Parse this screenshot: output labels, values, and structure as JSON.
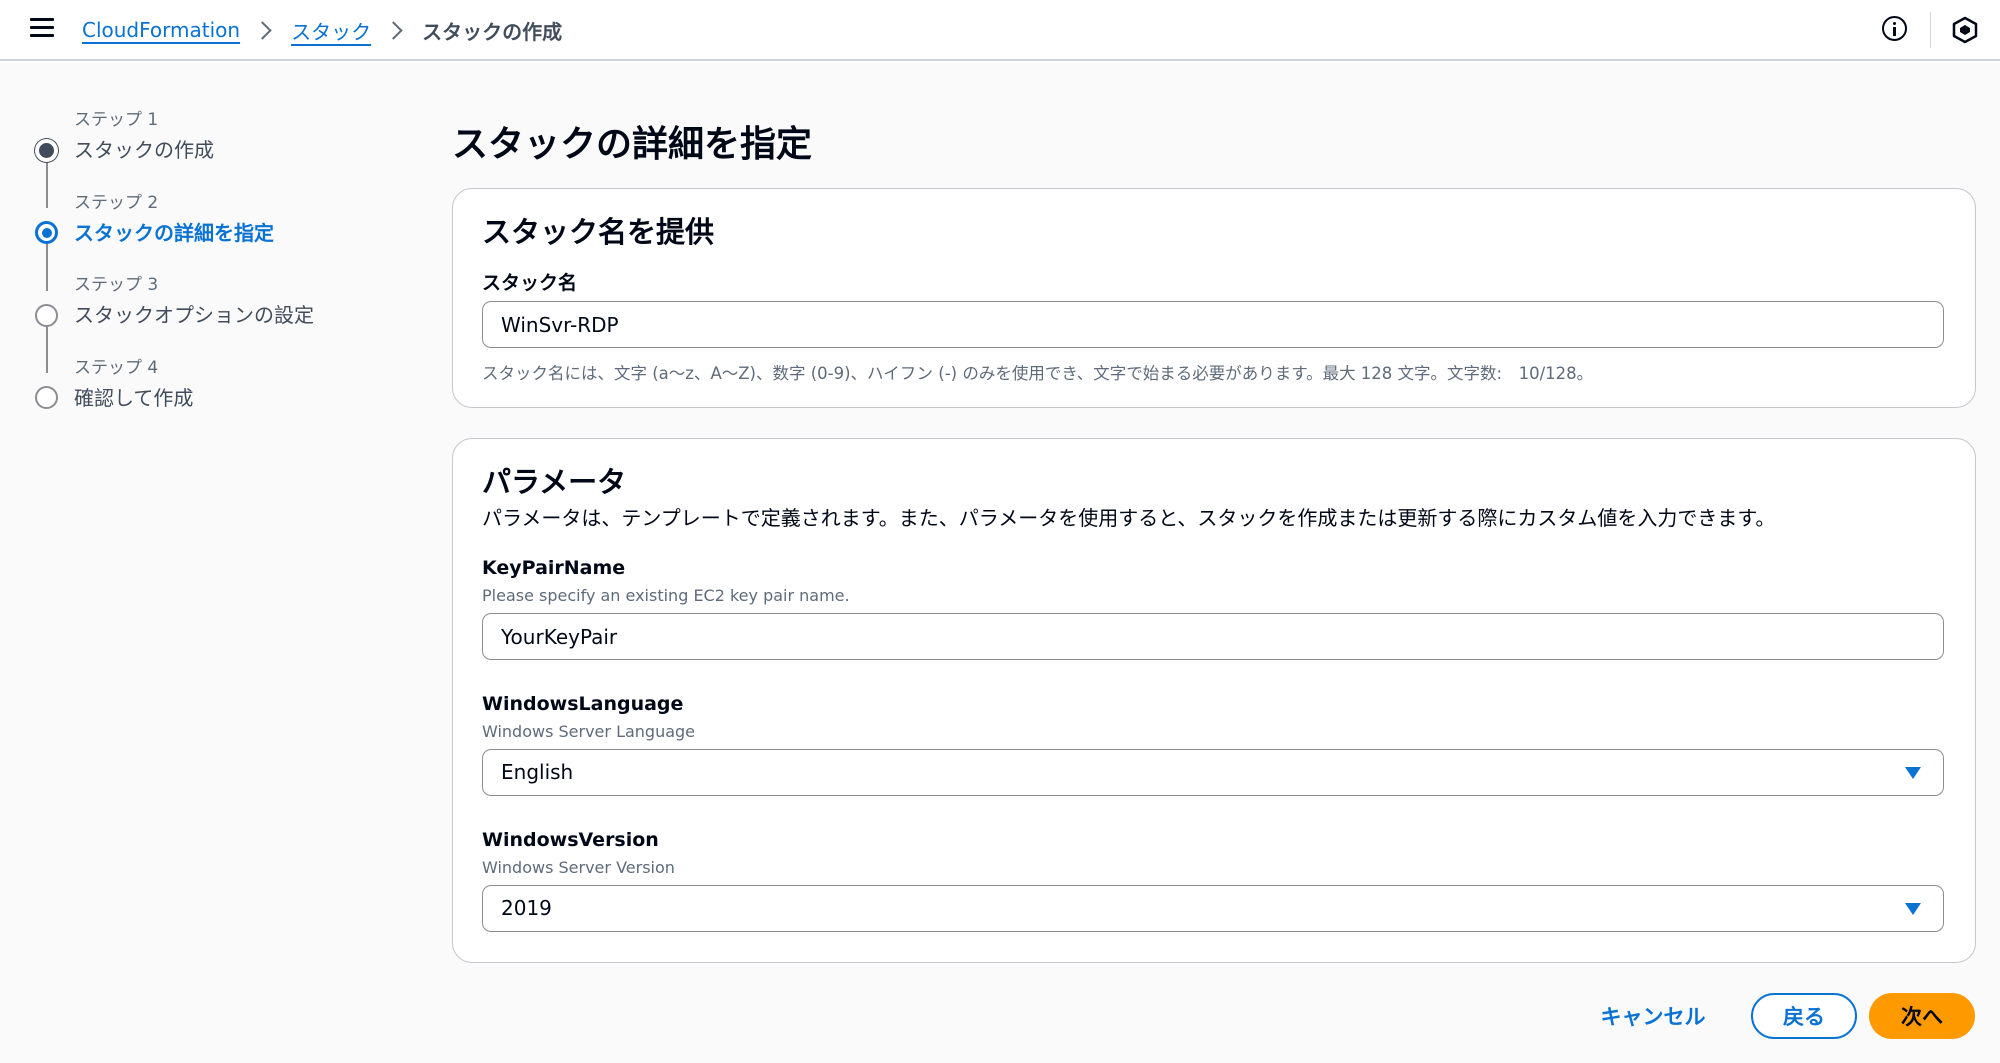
{
  "breadcrumb": {
    "items": [
      "CloudFormation",
      "スタック"
    ],
    "current": "スタックの作成"
  },
  "icons": {
    "menu": "hamburger-menu-icon",
    "info": "info-icon",
    "notifications": "hexagon-icon"
  },
  "steps": [
    {
      "number": "ステップ 1",
      "title": "スタックの作成",
      "state": "done"
    },
    {
      "number": "ステップ 2",
      "title": "スタックの詳細を指定",
      "state": "current"
    },
    {
      "number": "ステップ 3",
      "title": "スタックオプションの設定",
      "state": "future"
    },
    {
      "number": "ステップ 4",
      "title": "確認して作成",
      "state": "future"
    }
  ],
  "page_title": "スタックの詳細を指定",
  "stack_name_section": {
    "heading": "スタック名を提供",
    "label": "スタック名",
    "value": "WinSvr-RDP",
    "constraint": "スタック名には、文字 (a〜z、A〜Z)、数字 (0-9)、ハイフン (-) のみを使用でき、文字で始まる必要があります。最大 128 文字。文字数:　10/128。"
  },
  "parameters_section": {
    "heading": "パラメータ",
    "description": "パラメータは、テンプレートで定義されます。また、パラメータを使用すると、スタックを作成または更新する際にカスタム値を入力できます。",
    "fields": [
      {
        "label": "KeyPairName",
        "description": "Please specify an existing EC2 key pair name.",
        "value": "YourKeyPair",
        "type": "text"
      },
      {
        "label": "WindowsLanguage",
        "description": "Windows Server Language",
        "value": "English",
        "type": "select"
      },
      {
        "label": "WindowsVersion",
        "description": "Windows Server Version",
        "value": "2019",
        "type": "select"
      }
    ]
  },
  "footer": {
    "cancel_label": "キャンセル",
    "back_label": "戻る",
    "next_label": "次へ"
  },
  "colors": {
    "accent": "#0972d3",
    "primary_button": "#ff9900",
    "text": "#000716",
    "muted_text": "#5f6b7a"
  }
}
